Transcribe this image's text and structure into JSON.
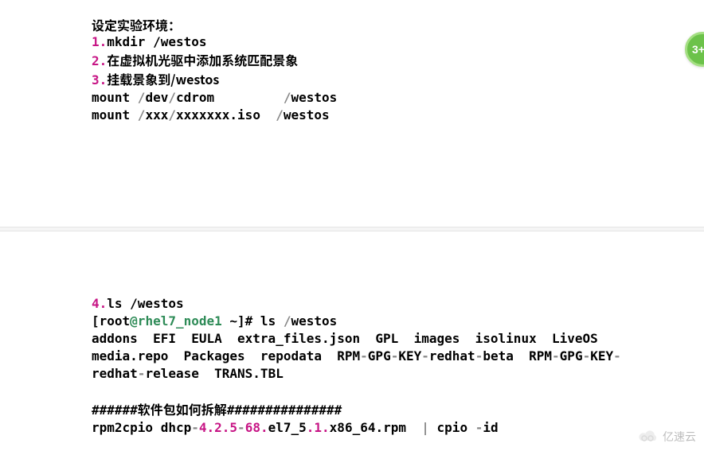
{
  "panel1": {
    "title": "设定实验环境：",
    "steps": {
      "s1_num": "1.",
      "s1_txt": "mkdir /westos",
      "s2_num": "2.",
      "s2_txt": "在虚拟机光驱中添加系统匹配景象",
      "s3_num": "3.",
      "s3_txt": "挂载景象到/westos"
    },
    "mount1_a": "mount ",
    "mount1_b": "/",
    "mount1_c": "dev",
    "mount1_d": "/",
    "mount1_e": "cdrom         ",
    "mount1_f": "/",
    "mount1_g": "westos",
    "mount2_a": "mount ",
    "mount2_b": "/",
    "mount2_c": "xxx",
    "mount2_d": "/",
    "mount2_e": "xxxxxxx.iso  ",
    "mount2_f": "/",
    "mount2_g": "westos"
  },
  "panel2": {
    "s4_num": "4.",
    "s4_txt": "ls /westos",
    "prompt_a": "[root",
    "prompt_b": "@rhel7_node1",
    "prompt_c": " ~",
    "prompt_d": "]# ls ",
    "prompt_e": "/",
    "prompt_f": "westos",
    "ls_out1_a": "addons  EFI  EULA  extra_files.json  GPL  images  isolinux  LiveOS",
    "ls_out2_a": "media.repo  Packages  repodata  RPM",
    "dash": "-",
    "ls_out2_b": "GPG",
    "ls_out2_c": "KEY",
    "ls_out2_d": "redhat",
    "ls_out2_e": "beta",
    "ls_out2_f": "RPM",
    "ls_out2_g": "GPG",
    "ls_out2_h": "KEY",
    "ls_out3_a": "redhat",
    "ls_out3_b": "release  TRANS.TBL",
    "sect_a": "######",
    "sect_b": "软件包如何拆解",
    "sect_c": "###############",
    "rpm_a": "rpm2cpio dhcp",
    "rpm_b": "4.2.5",
    "rpm_c": "68.",
    "rpm_d": "el7_5",
    "rpm_e": ".1.",
    "rpm_f": "x86_64.rpm  ",
    "rpm_g": "|",
    "rpm_h": " cpio ",
    "rpm_i": "-",
    "rpm_j": "id"
  },
  "badge": "3+",
  "watermark": "亿速云"
}
